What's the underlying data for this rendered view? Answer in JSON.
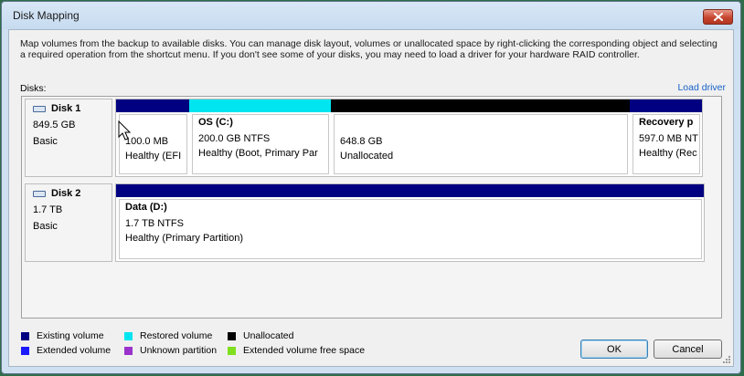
{
  "window": {
    "title": "Disk Mapping"
  },
  "description": "Map volumes from the backup to available disks. You can manage disk layout, volumes or unallocated space by right-clicking the corresponding object and selecting a required operation from the shortcut menu. If you don't see some of your disks, you may need to load a driver for your hardware RAID controller.",
  "disks_label": "Disks:",
  "load_driver": "Load driver",
  "disks": [
    {
      "name": "Disk 1",
      "size": "849.5 GB",
      "type": "Basic",
      "partitions": [
        {
          "title": "",
          "line1": "100.0 MB",
          "line2": "Healthy (EFI",
          "color": "#000080"
        },
        {
          "title": "OS (C:)",
          "line1": "200.0 GB NTFS",
          "line2": "Healthy (Boot, Primary Par",
          "color": "#00e5f0"
        },
        {
          "title": "",
          "line1": "648.8 GB",
          "line2": "Unallocated",
          "color": "#000000"
        },
        {
          "title": "Recovery p",
          "line1": "597.0 MB NT",
          "line2": "Healthy (Rec",
          "color": "#000080"
        }
      ]
    },
    {
      "name": "Disk 2",
      "size": "1.7 TB",
      "type": "Basic",
      "partitions": [
        {
          "title": "Data (D:)",
          "line1": "1.7 TB NTFS",
          "line2": "Healthy (Primary Partition)",
          "color": "#000080"
        }
      ]
    }
  ],
  "legend": [
    {
      "label": "Existing volume",
      "color": "#000080"
    },
    {
      "label": "Restored volume",
      "color": "#00e5f0"
    },
    {
      "label": "Unallocated",
      "color": "#000000"
    },
    {
      "label": "Extended volume",
      "color": "#1a1aff"
    },
    {
      "label": "Unknown partition",
      "color": "#9933cc"
    },
    {
      "label": "Extended volume free space",
      "color": "#80e020"
    }
  ],
  "buttons": {
    "ok": "OK",
    "cancel": "Cancel"
  }
}
